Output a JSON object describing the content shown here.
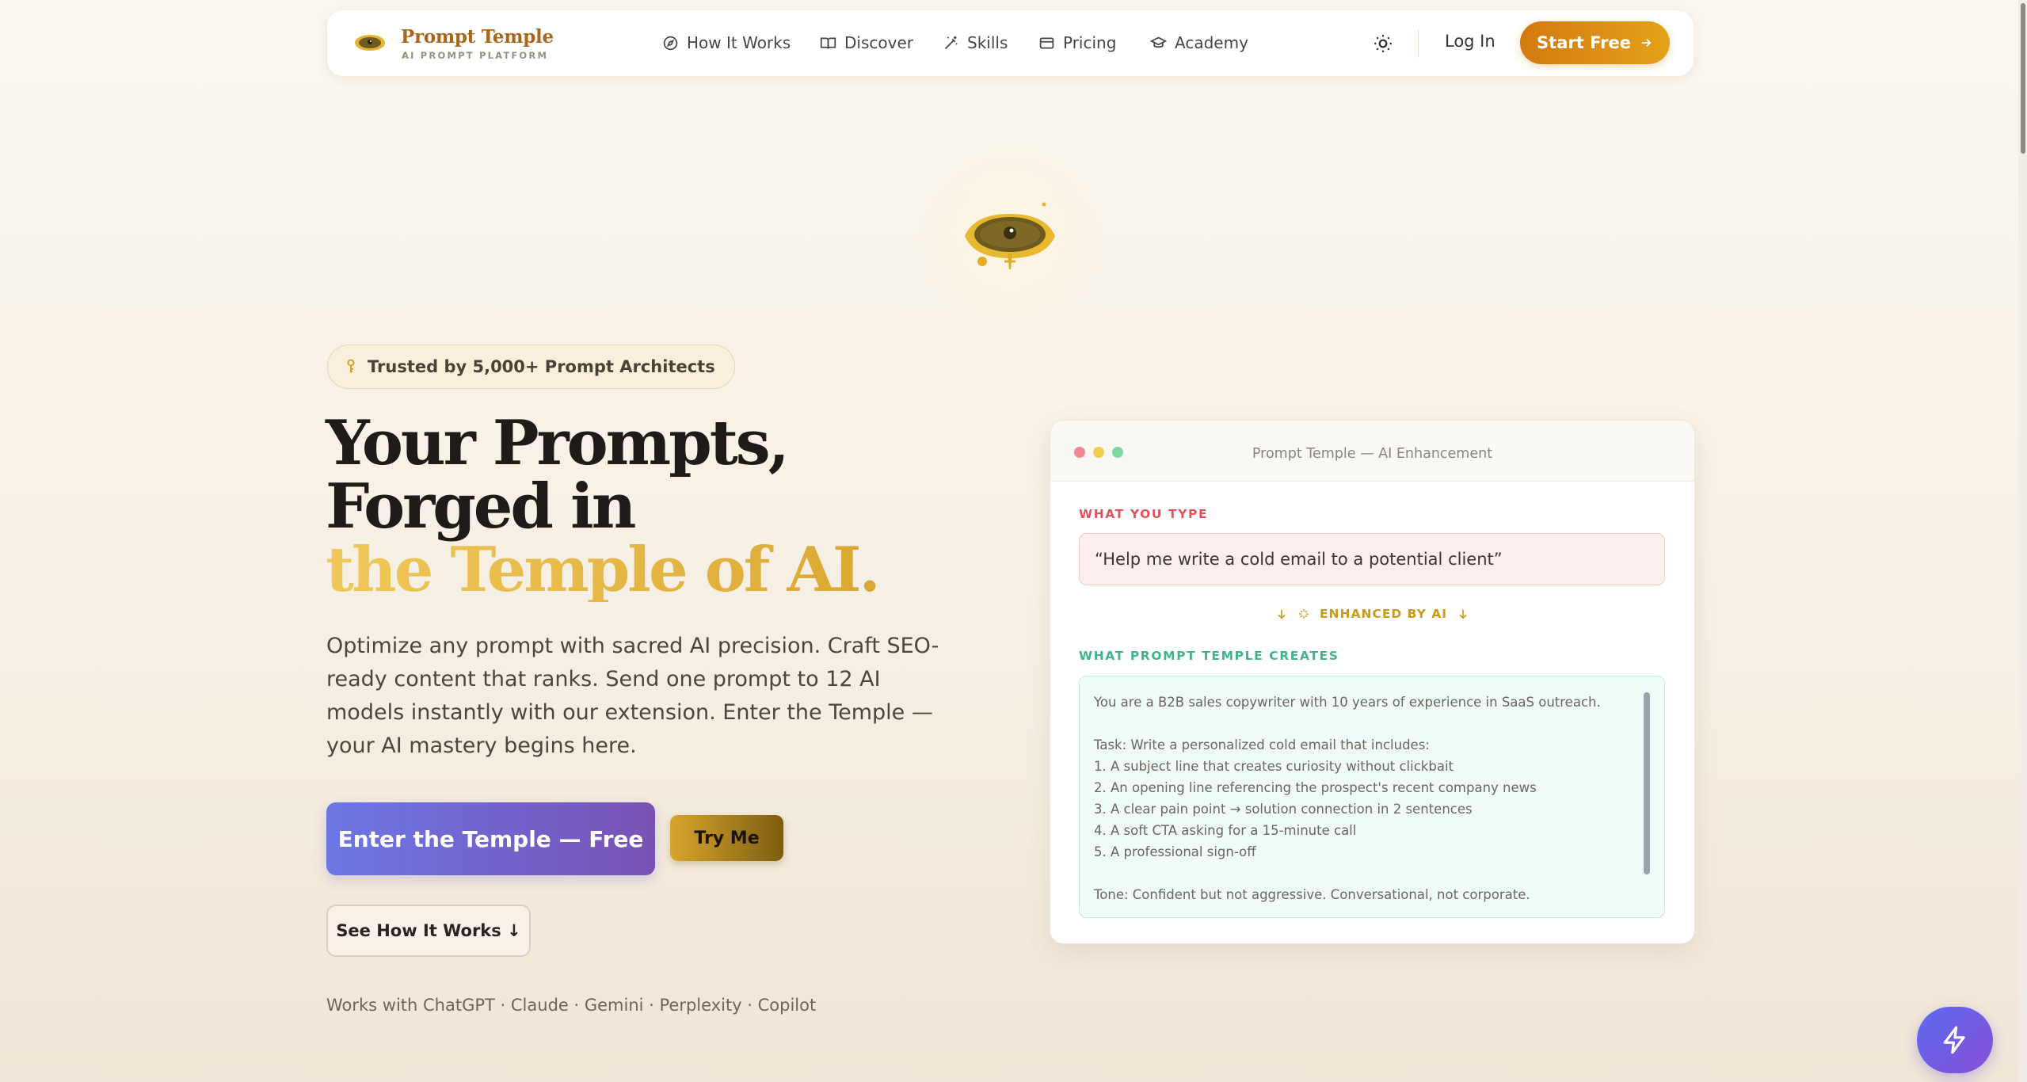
{
  "brand": {
    "title": "Prompt Temple",
    "subtitle": "AI PROMPT PLATFORM"
  },
  "nav": {
    "links": [
      {
        "label": "How It Works",
        "icon": "compass-icon"
      },
      {
        "label": "Discover",
        "icon": "book-open-icon"
      },
      {
        "label": "Skills",
        "icon": "magic-wand-icon"
      },
      {
        "label": "Pricing",
        "icon": "credit-card-icon"
      },
      {
        "label": "Academy",
        "icon": "graduation-cap-icon"
      }
    ],
    "theme_icon": "sun-icon",
    "login": "Log In",
    "start_free": "Start Free"
  },
  "hero": {
    "badge": "Trusted by 5,000+ Prompt Architects",
    "headline_line1": "Your Prompts, Forged in",
    "headline_line2": "the Temple of AI.",
    "lead": "Optimize any prompt with sacred AI precision. Craft SEO-ready content that ranks. Send one prompt to 12 AI models instantly with our extension. Enter the Temple — your AI mastery begins here.",
    "cta_primary": "Enter the Temple — Free",
    "cta_try": "Try Me",
    "cta_how": "See How It Works ↓",
    "works_with": "Works with ChatGPT · Claude · Gemini · Perplexity · Copilot"
  },
  "demo": {
    "window_title": "Prompt Temple — AI Enhancement",
    "input_label": "WHAT YOU TYPE",
    "input_text": "“Help me write a cold email to a potential client”",
    "enhanced_label": "ENHANCED BY AI",
    "output_label": "WHAT PROMPT TEMPLE CREATES",
    "output_lines": [
      "You are a B2B sales copywriter with 10 years of experience in SaaS outreach.",
      "",
      "Task: Write a personalized cold email that includes:",
      "1. A subject line that creates curiosity without clickbait",
      "2. An opening line referencing the prospect's recent company news",
      "3. A clear pain point → solution connection in 2 sentences",
      "4. A soft CTA asking for a 15-minute call",
      "5. A professional sign-off",
      "",
      "Tone: Confident but not aggressive. Conversational, not corporate."
    ]
  },
  "colors": {
    "brand_orange": "#d3790e",
    "gold": "#e0b23e",
    "primary_gradient_start": "#6b77e6",
    "primary_gradient_end": "#7a52b5",
    "red_label": "#e0545c",
    "green_label": "#3eb58a"
  },
  "fab": {
    "icon": "lightning-icon"
  }
}
